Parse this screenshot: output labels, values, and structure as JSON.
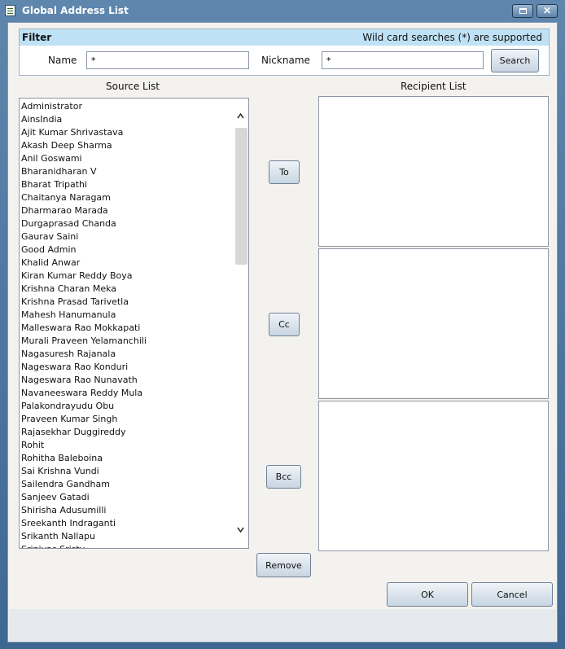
{
  "window": {
    "title": "Global Address List"
  },
  "filter": {
    "title": "Filter",
    "hint": "Wild card searches (*) are supported",
    "name_label": "Name",
    "name_value": "*",
    "nickname_label": "Nickname",
    "nickname_value": "*",
    "search_label": "Search"
  },
  "source": {
    "title": "Source List",
    "items": [
      "Administrator",
      "AinsIndia",
      "Ajit Kumar Shrivastava",
      "Akash Deep Sharma",
      "Anil Goswami",
      "Bharanidharan V",
      "Bharat Tripathi",
      "Chaitanya Naragam",
      "Dharmarao Marada",
      "Durgaprasad Chanda",
      "Gaurav Saini",
      "Good Admin",
      "Khalid Anwar",
      "Kiran Kumar Reddy Boya",
      "Krishna Charan Meka",
      "Krishna Prasad Tarivetla",
      "Mahesh Hanumanula",
      "Malleswara Rao Mokkapati",
      "Murali Praveen Yelamanchili",
      "Nagasuresh Rajanala",
      "Nageswara Rao Konduri",
      "Nageswara Rao Nunavath",
      "Navaneeswara Reddy Mula",
      "Palakondrayudu Obu",
      "Praveen Kumar Singh",
      "Rajasekhar Duggireddy",
      "Rohit",
      "Rohitha Baleboina",
      "Sai Krishna Vundi",
      "Sailendra Gandham",
      "Sanjeev Gatadi",
      "Shirisha Adusumilli",
      "Sreekanth Indraganti",
      "Srikanth Nallapu",
      "Srinivas Sristy"
    ]
  },
  "recipient": {
    "title": "Recipient List"
  },
  "actions": {
    "to": "To",
    "cc": "Cc",
    "bcc": "Bcc",
    "remove": "Remove"
  },
  "footer": {
    "ok": "OK",
    "cancel": "Cancel"
  },
  "icons": {
    "window": "address-list-icon",
    "maximize": "maximize-icon",
    "close": "close-icon",
    "scroll_up": "chevron-up-icon",
    "scroll_down": "chevron-down-icon"
  },
  "colors": {
    "title_bar": "#4a7199",
    "filter_header": "#bfe1f5",
    "dialog_background": "#f4f2ee"
  }
}
